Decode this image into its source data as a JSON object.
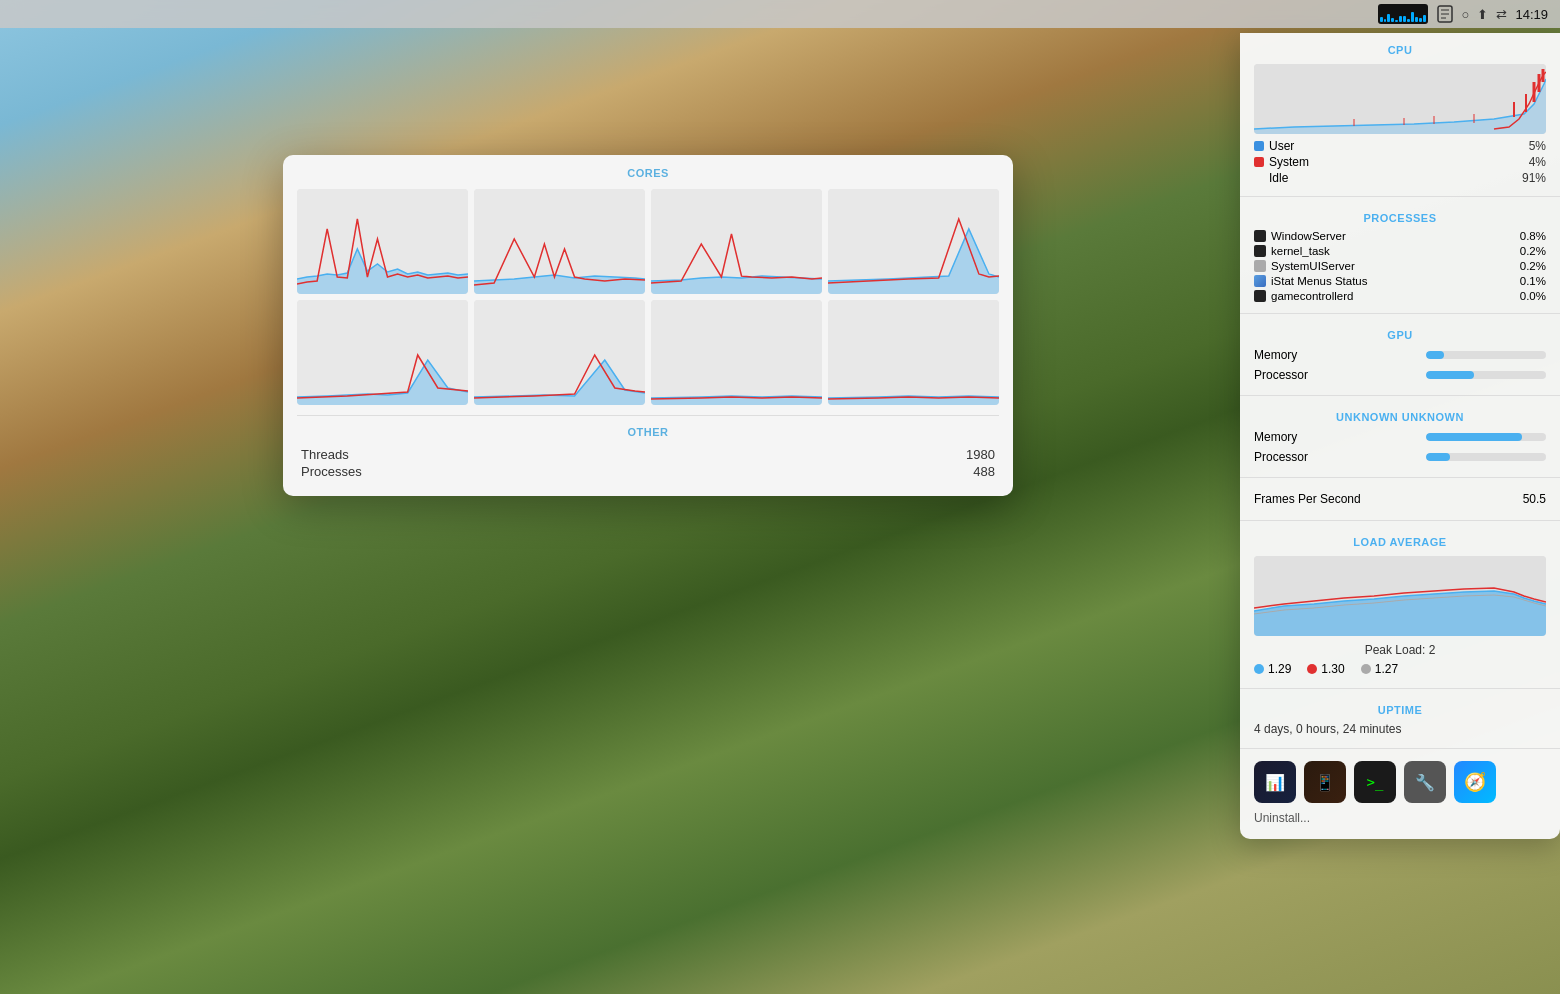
{
  "menubar": {
    "time": "14:19",
    "icons": [
      "cpu-monitor",
      "memory-monitor",
      "circle",
      "upload",
      "switch"
    ]
  },
  "cores_popup": {
    "title": "CORES",
    "other_title": "OTHER",
    "threads_label": "Threads",
    "threads_value": "1980",
    "processes_label": "Processes",
    "processes_value": "488"
  },
  "istat": {
    "cpu_section_title": "CPU",
    "user_label": "User",
    "user_value": "5%",
    "system_label": "System",
    "system_value": "4%",
    "idle_label": "Idle",
    "idle_value": "91%",
    "processes_title": "PROCESSES",
    "processes": [
      {
        "name": "WindowServer",
        "value": "0.8%"
      },
      {
        "name": "kernel_task",
        "value": "0.2%"
      },
      {
        "name": "SystemUIServer",
        "value": "0.2%"
      },
      {
        "name": "iStat Menus Status",
        "value": "0.1%"
      },
      {
        "name": "gamecontrollerd",
        "value": "0.0%"
      }
    ],
    "gpu_title": "GPU",
    "gpu_memory_label": "Memory",
    "gpu_processor_label": "Processor",
    "gpu_memory_pct": 15,
    "gpu_processor_pct": 40,
    "unknown_title": "UNKNOWN UNKNOWN",
    "unk_memory_label": "Memory",
    "unk_processor_label": "Processor",
    "unk_memory_pct": 80,
    "unk_processor_pct": 20,
    "fps_label": "Frames Per Second",
    "fps_value": "50.5",
    "load_title": "LOAD AVERAGE",
    "peak_load_label": "Peak Load: 2",
    "load_1": "1.29",
    "load_5": "1.30",
    "load_15": "1.27",
    "uptime_title": "UPTIME",
    "uptime_value": "4 days, 0 hours, 24 minutes",
    "uninstall_label": "Uninstall..."
  }
}
